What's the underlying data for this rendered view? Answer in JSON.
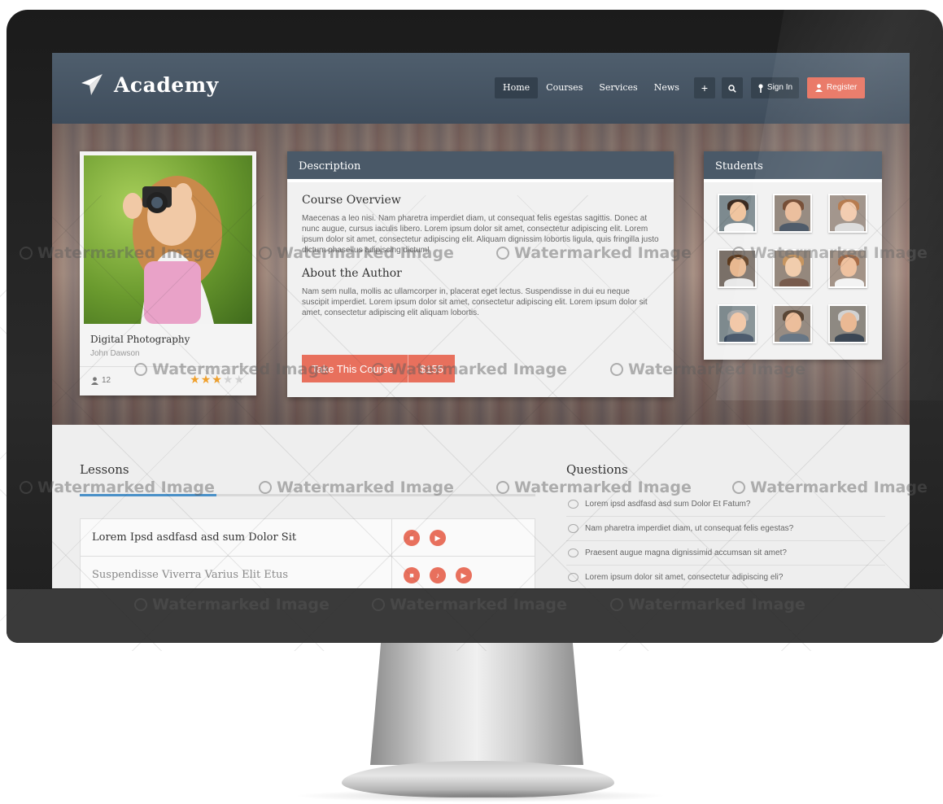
{
  "brand": {
    "name": "Academy"
  },
  "nav": {
    "items": [
      "Home",
      "Courses",
      "Services",
      "News"
    ],
    "active": "Home",
    "plus_glyph": "+",
    "search_icon": "search-icon",
    "signin_label": "Sign In",
    "register_label": "Register"
  },
  "course_card": {
    "title": "Digital Photography",
    "author": "John Dawson",
    "students": "12",
    "rating": 3,
    "rating_max": 5
  },
  "description": {
    "header": "Description",
    "overview_title": "Course Overview",
    "overview_text": "Maecenas a leo nisi. Nam pharetra imperdiet diam, ut consequat felis egestas sagittis. Donec at nunc augue, cursus iaculis libero. Lorem ipsum dolor sit amet, consectetur adipiscing elit. Lorem ipsum dolor sit amet, consectetur adipiscing elit. Aliquam dignissim lobortis ligula, quis fringilla justo dictum phasellus adipiscing dictum!",
    "author_title": "About the Author",
    "author_text": "Nam sem nulla, mollis ac ullamcorper in, placerat eget lectus. Suspendisse in dui eu neque suscipit imperdiet. Lorem ipsum dolor sit amet, consectetur adipiscing elit. Lorem ipsum dolor sit amet, consectetur adipiscing elit aliquam lobortis.",
    "cta_label": "Take This Course",
    "cta_price": "$155"
  },
  "students_panel": {
    "header": "Students"
  },
  "lessons": {
    "title": "Lessons",
    "progress": 0.3,
    "rows": [
      {
        "name": "Lorem Ipsd asdfasd asd sum Dolor Sit"
      },
      {
        "name": "Suspendisse Viverra Varius Elit Etus"
      }
    ]
  },
  "questions": {
    "title": "Questions",
    "items": [
      "Lorem ipsd asdfasd asd sum Dolor Et Fatum?",
      "Nam pharetra imperdiet diam, ut consequat felis egestas?",
      "Praesent augue magna dignissimid accumsan sit amet?",
      "Lorem ipsum dolor sit amet, consectetur adipiscing eli?"
    ]
  },
  "watermark": {
    "text": "Watermarked Image"
  },
  "colors": {
    "nav_bg": "#4a5968",
    "accent": "#e8705d",
    "progress": "#4a90c8",
    "star": "#f0a02c"
  }
}
